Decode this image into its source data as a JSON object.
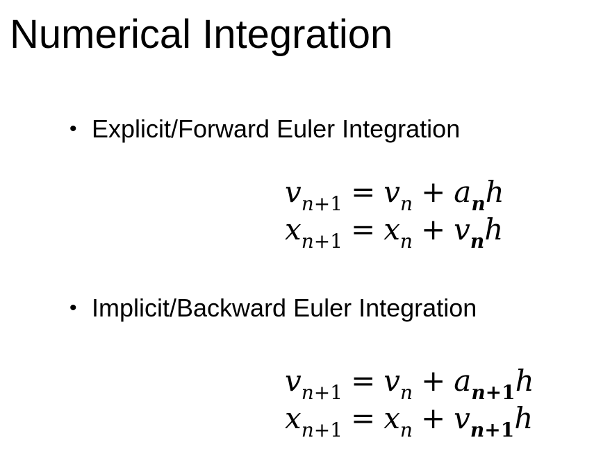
{
  "slide": {
    "title": "Numerical Integration",
    "sections": [
      {
        "bullet": "Explicit/Forward Euler Integration",
        "equations": [
          {
            "lhs_var": "v",
            "lhs_sub": "n+1",
            "eq": "=",
            "t1_var": "v",
            "t1_sub": "n",
            "plus": "+",
            "t2_var": "a",
            "t2_sub": "n",
            "t2_sub_bold": true,
            "t3_var": "h"
          },
          {
            "lhs_var": "x",
            "lhs_sub": "n+1",
            "eq": "=",
            "t1_var": "x",
            "t1_sub": "n",
            "plus": "+",
            "t2_var": "v",
            "t2_sub": "n",
            "t2_sub_bold": true,
            "t3_var": "h"
          }
        ]
      },
      {
        "bullet": "Implicit/Backward Euler Integration",
        "equations": [
          {
            "lhs_var": "v",
            "lhs_sub": "n+1",
            "eq": "=",
            "t1_var": "v",
            "t1_sub": "n",
            "plus": "+",
            "t2_var": "a",
            "t2_sub": "n+1",
            "t2_sub_bold": true,
            "t3_var": "h"
          },
          {
            "lhs_var": "x",
            "lhs_sub": "n+1",
            "eq": "=",
            "t1_var": "x",
            "t1_sub": "n",
            "plus": "+",
            "t2_var": "v",
            "t2_sub": "n+1",
            "t2_sub_bold": true,
            "t3_var": "h"
          }
        ]
      }
    ]
  }
}
